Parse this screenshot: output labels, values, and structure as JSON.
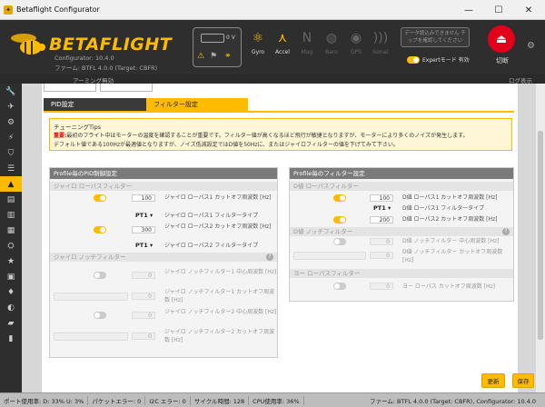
{
  "window": {
    "title": "Betaflight Configurator",
    "min": "—",
    "max": "☐",
    "close": "✕"
  },
  "header": {
    "brand": "BETAFLIGHT",
    "version_line": "Configurator: 10.4.0",
    "firmware_line": "ファーム: BTFL 4.0.0 (Target: CBFR)",
    "battery_voltage": "0 V",
    "sensors": [
      {
        "label": "Gyro",
        "icon": "gyro-icon",
        "active": true
      },
      {
        "label": "Accel",
        "icon": "accel-icon",
        "active": true
      },
      {
        "label": "Mag",
        "icon": "mag-icon",
        "active": false
      },
      {
        "label": "Baro",
        "icon": "baro-icon",
        "active": false
      },
      {
        "label": "GPS",
        "icon": "gps-icon",
        "active": false
      },
      {
        "label": "Sonar",
        "icon": "sonar-icon",
        "active": false
      }
    ],
    "notice": "データ読込みできません チップを確認してください",
    "expert_mode": "Expertモード 有効",
    "disconnect": "切断",
    "accent": "#ffbb00",
    "disconnect_color": "#e2001a"
  },
  "subheader": {
    "armed": "アーミング無効",
    "log": "ログ表示"
  },
  "sidebar": {
    "items": [
      "wrench-icon",
      "rocket-icon",
      "gear-icon",
      "plug-icon",
      "wifi-icon",
      "radio-icon",
      "motors-icon",
      "tune-icon",
      "receiver-icon",
      "modes-icon",
      "servo-icon",
      "gps-icon",
      "osd-icon",
      "flash-icon",
      "battery-icon",
      "blackbox-icon",
      "cli-icon"
    ]
  },
  "tabs": {
    "pid": "PID設定",
    "filter": "フィルター設定"
  },
  "tips": {
    "title": "チューニングTips",
    "warn": "重要:",
    "line1": "最初のフライト中はモーターの温度を確認することが重要です。フィルター値が高くなるほど飛行が敏捷となりますが、モーターにより多くのノイズが発生します。",
    "line2": "デフォルト値である100Hzが最適値となりますが、ノイズ低減設定ではD値を50Hzに、またはジャイロフィルターの値を下げてみて下さい。"
  },
  "left_panel": {
    "title": "Profile毎のPID制御設定",
    "gyro_lowpass": "ジャイロ ローパスフィルター",
    "lp1_hz_value": "100",
    "lp1_hz_label": "ジャイロ ローパス1 カットオフ周波数 [Hz]",
    "lp1_type_value": "PT1",
    "lp1_type_label": "ジャイロ ローパス1 フィルタータイプ",
    "lp2_hz_value": "300",
    "lp2_hz_label": "ジャイロ ローパス2 カットオフ周波数 [Hz]",
    "lp2_type_value": "PT1",
    "lp2_type_label": "ジャイロ ローパス2 フィルタータイプ",
    "gyro_notch": "ジャイロ ノッチフィルター",
    "help": "?",
    "n1_center_value": "0",
    "n1_center_label": "ジャイロ ノッチフィルター1 中心周波数 [Hz]",
    "n1_cutoff_value": "0",
    "n1_cutoff_label": "ジャイロ ノッチフィルター1 カットオフ周波数 [Hz]",
    "n2_center_value": "0",
    "n2_center_label": "ジャイロ ノッチフィルター2 中心周波数 [Hz]",
    "n2_cutoff_value": "0",
    "n2_cutoff_label": "ジャイロ ノッチフィルター2 カットオフ周波数 [Hz]"
  },
  "right_panel": {
    "title": "Profile毎のフィルター設定",
    "d_lowpass": "D値 ローパスフィルター",
    "d_lp1_hz_value": "100",
    "d_lp1_hz_label": "D値 ローパス1 カットオフ周波数 [Hz]",
    "d_lp1_type_value": "PT1",
    "d_lp1_type_label": "D値 ローパス1 フィルタータイプ",
    "d_lp2_hz_value": "200",
    "d_lp2_hz_label": "D値 ローパス2 カットオフ周波数 [Hz]",
    "d_notch": "D値 ノッチフィルター",
    "help": "?",
    "dn_center_value": "0",
    "dn_center_label": "D値 ノッチフィルター 中心周波数 [Hz]",
    "dn_cutoff_value": "0",
    "dn_cutoff_label": "D値 ノッチフィルター カットオフ周波数 [Hz]",
    "yaw_lowpass": "ヨー ローパスフィルター",
    "yaw_value": "0",
    "yaw_label": "ヨー ローパス カットオフ周波数 [Hz]"
  },
  "buttons": {
    "refresh": "更新",
    "save": "保存"
  },
  "statusbar": {
    "port": "ポート使用率: D: 33% U: 3%",
    "packet": "パケットエラー: 0",
    "i2c": "I2C エラー: 0",
    "cycle": "サイクル時間: 128",
    "cpu": "CPU使用率: 36%",
    "fw": "ファーム: BTFL 4.0.0 (Target: CBFR), Configurator: 10.4.0"
  }
}
